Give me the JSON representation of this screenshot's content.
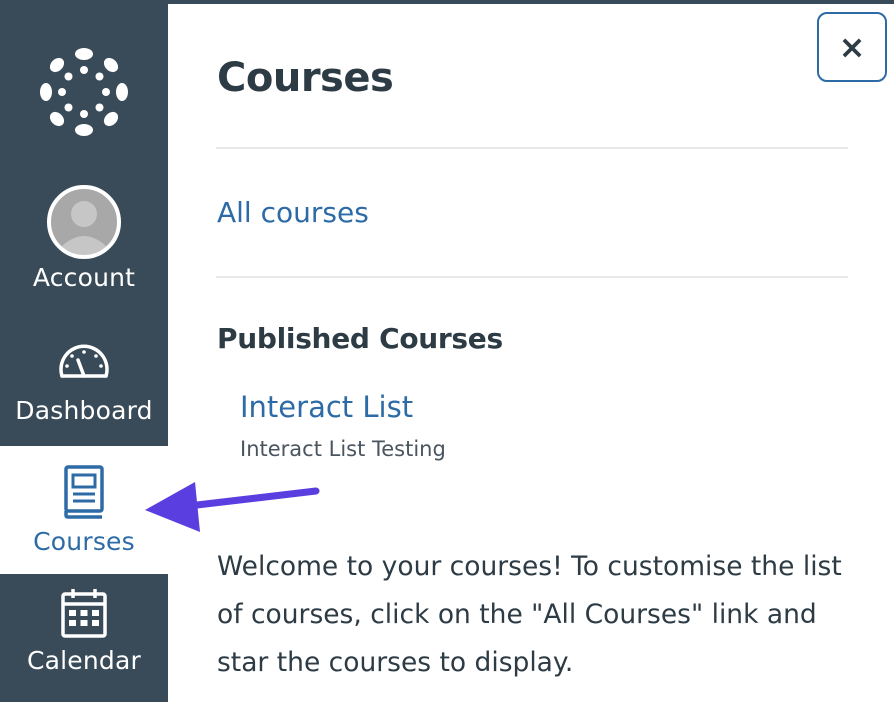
{
  "sidebar": {
    "logo_name": "canvas-logo",
    "items": [
      {
        "label": "Account",
        "icon": "avatar-icon",
        "active": false
      },
      {
        "label": "Dashboard",
        "icon": "speedometer-icon",
        "active": false
      },
      {
        "label": "Courses",
        "icon": "book-icon",
        "active": true
      },
      {
        "label": "Calendar",
        "icon": "calendar-icon",
        "active": false
      }
    ]
  },
  "tray": {
    "title": "Courses",
    "close_label": "×",
    "all_courses_link": "All courses",
    "section_heading": "Published Courses",
    "courses": [
      {
        "name": "Interact List",
        "subtitle": "Interact List Testing"
      }
    ],
    "welcome_text": "Welcome to your courses! To customise the list of courses, click on the \"All Courses\" link and star the courses to display."
  },
  "colors": {
    "sidebar_bg": "#394b58",
    "link": "#2d6ba6",
    "text": "#2d3b45",
    "arrow": "#5b3ee0"
  }
}
